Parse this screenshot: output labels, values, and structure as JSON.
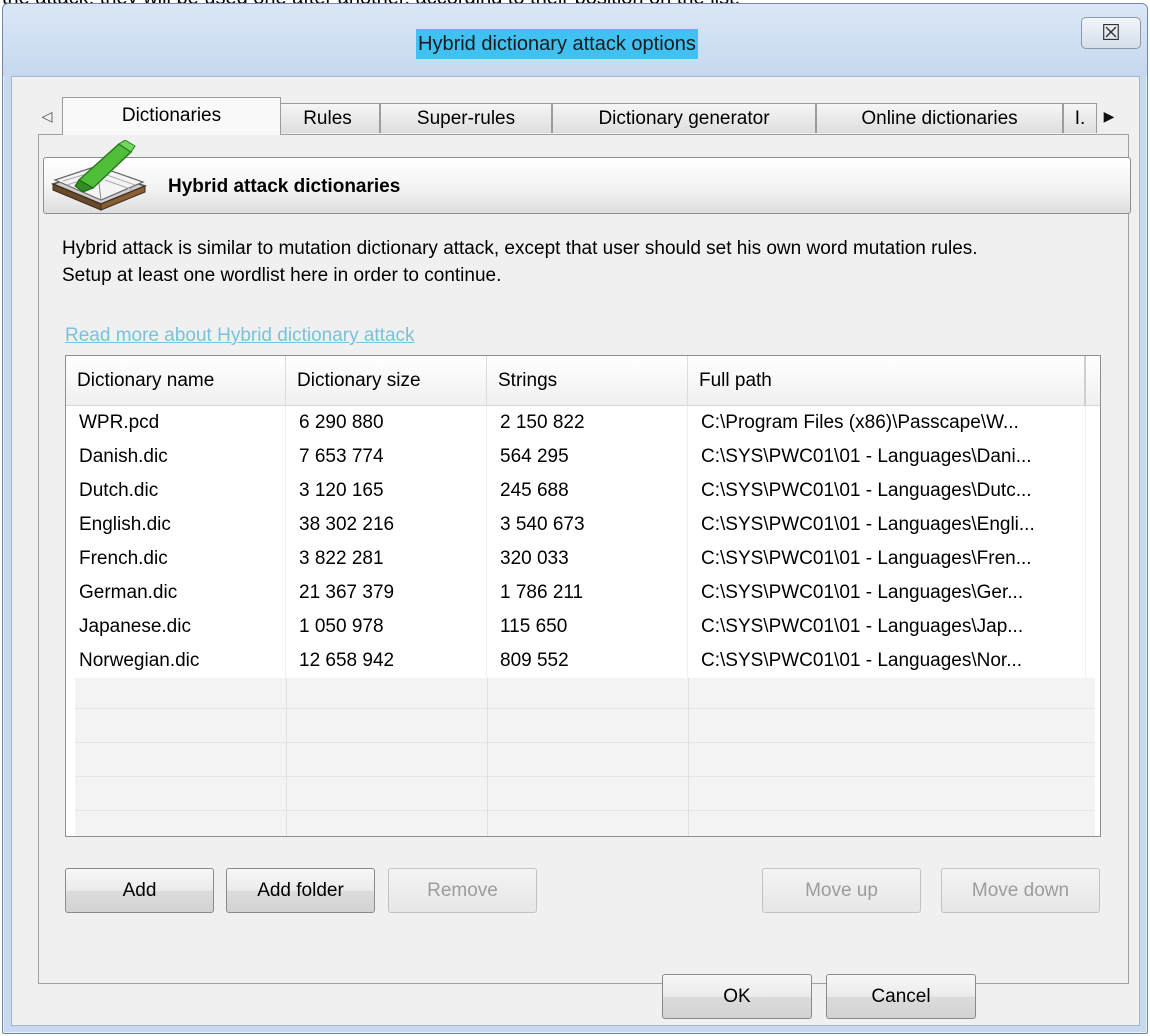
{
  "page_caption": "the attack, they will be used one after another, according to their position on the list.",
  "window": {
    "title": "Hybrid dictionary attack options",
    "close_glyph": "☒"
  },
  "tabs": [
    {
      "label": "Dictionaries",
      "active": true
    },
    {
      "label": "Rules",
      "active": false
    },
    {
      "label": "Super-rules",
      "active": false
    },
    {
      "label": "Dictionary generator",
      "active": false
    },
    {
      "label": "Online dictionaries",
      "active": false
    },
    {
      "label": "I.",
      "active": false
    }
  ],
  "section": {
    "title": "Hybrid attack dictionaries",
    "icon": "book-icon"
  },
  "description": {
    "line1": "Hybrid attack is similar to mutation dictionary attack, except that user should set his own word mutation rules.",
    "line2": "Setup at least one wordlist here in order to continue."
  },
  "link": "Read more about Hybrid dictionary attack",
  "table": {
    "columns": [
      "Dictionary name",
      "Dictionary size",
      "Strings",
      "Full path"
    ],
    "rows": [
      [
        "WPR.pcd",
        "6 290 880",
        "2 150 822",
        "C:\\Program Files (x86)\\Passcape\\W..."
      ],
      [
        "Danish.dic",
        "7 653 774",
        "564 295",
        "C:\\SYS\\PWC01\\01 - Languages\\Dani..."
      ],
      [
        "Dutch.dic",
        "3 120 165",
        "245 688",
        "C:\\SYS\\PWC01\\01 - Languages\\Dutc..."
      ],
      [
        "English.dic",
        "38 302 216",
        "3 540 673",
        "C:\\SYS\\PWC01\\01 - Languages\\Engli..."
      ],
      [
        "French.dic",
        "3 822 281",
        "320 033",
        "C:\\SYS\\PWC01\\01 - Languages\\Fren..."
      ],
      [
        "German.dic",
        "21 367 379",
        "1 786 211",
        "C:\\SYS\\PWC01\\01 - Languages\\Ger..."
      ],
      [
        "Japanese.dic",
        "1 050 978",
        "115 650",
        "C:\\SYS\\PWC01\\01 - Languages\\Jap..."
      ],
      [
        "Norwegian.dic",
        "12 658 942",
        "809 552",
        "C:\\SYS\\PWC01\\01 - Languages\\Nor..."
      ]
    ]
  },
  "buttons": {
    "add": "Add",
    "add_folder": "Add folder",
    "remove": "Remove",
    "move_up": "Move up",
    "move_down": "Move down",
    "ok": "OK",
    "cancel": "Cancel"
  }
}
